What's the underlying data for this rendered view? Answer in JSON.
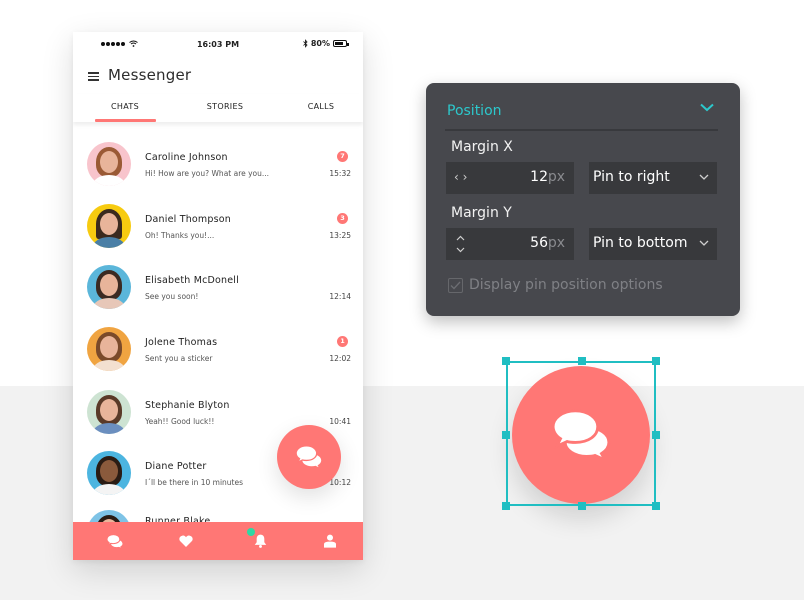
{
  "status_bar": {
    "time": "16:03 PM",
    "battery_percent": "80%",
    "battery_level": 0.8,
    "icons": [
      "signal-dots-icon",
      "wifi-icon",
      "bluetooth-icon",
      "battery-icon"
    ]
  },
  "app": {
    "title": "Messenger",
    "menu_icon": "hamburger-icon"
  },
  "tabs": [
    {
      "label": "CHATS",
      "active": true
    },
    {
      "label": "STORIES",
      "active": false
    },
    {
      "label": "CALLS",
      "active": false
    }
  ],
  "chats": [
    {
      "name": "Caroline Johnson",
      "message": "Hi! How are you? What are you...",
      "time": "15:32",
      "unread": "7"
    },
    {
      "name": "Daniel Thompson",
      "message": "Oh! Thanks you!...",
      "time": "13:25",
      "unread": "3"
    },
    {
      "name": "Elisabeth McDonell",
      "message": "See you soon!",
      "time": "12:14",
      "unread": null
    },
    {
      "name": "Jolene Thomas",
      "message": "Sent you a sticker",
      "time": "12:02",
      "unread": "1"
    },
    {
      "name": "Stephanie Blyton",
      "message": "Yeah!! Good luck!!",
      "time": "10:41",
      "unread": null
    },
    {
      "name": "Diane Potter",
      "message": "I´ll be there in 10 minutes",
      "time": "10:12",
      "unread": null
    },
    {
      "name": "Runner Blake",
      "message": "",
      "time": "",
      "unread": null
    }
  ],
  "bottom_nav": [
    {
      "icon": "chat-bubbles-icon"
    },
    {
      "icon": "heart-icon"
    },
    {
      "icon": "bell-icon",
      "has_notification": true
    },
    {
      "icon": "user-icon"
    }
  ],
  "colors": {
    "accent": "#ff7775",
    "teal": "#2cc8cc",
    "notification": "#2ed8a3",
    "panel_bg": "#47484d"
  },
  "panel": {
    "title": "Position",
    "margin_x": {
      "label": "Margin X",
      "value": "12",
      "unit": "px",
      "pin": "Pin to right"
    },
    "margin_y": {
      "label": "Margin Y",
      "value": "56",
      "unit": "px",
      "pin": "Pin to bottom"
    },
    "checkbox": {
      "label": "Display pin position options",
      "checked": true
    }
  }
}
